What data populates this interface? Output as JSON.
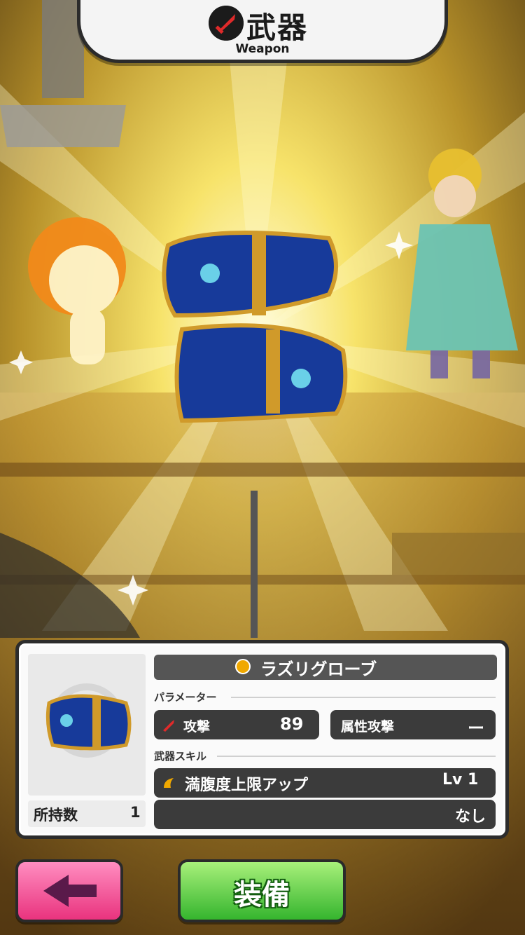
{
  "header": {
    "title": "武器",
    "subtitle": "Weapon"
  },
  "item": {
    "name": "ラズリグローブ",
    "owned_label": "所持数",
    "owned_count": "1"
  },
  "parameters": {
    "section_label": "パラメーター",
    "attack_label": "攻撃",
    "attack_value": "89",
    "element_attack_label": "属性攻撃",
    "element_attack_value": "ー"
  },
  "skill": {
    "section_label": "武器スキル",
    "name": "満腹度上限アップ",
    "level": "Lv 1",
    "secondary": "なし"
  },
  "buttons": {
    "equip_label": "装備"
  },
  "colors": {
    "accent_gold": "#f0a800",
    "back_button": "#e9337e",
    "equip_button": "#35b52e"
  },
  "icons": [
    "sword-icon",
    "orb-icon",
    "skill-icon",
    "back-arrow-icon"
  ]
}
